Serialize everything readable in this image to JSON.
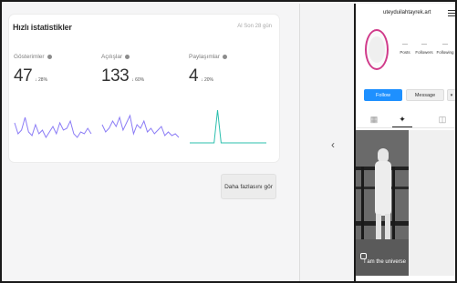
{
  "insights": {
    "title": "Hızlı istatistikler",
    "period": "Al Son 28 gün",
    "metrics": [
      {
        "label": "Gösterimler",
        "value": "47",
        "change": "↓ 28%",
        "color": "#8b7cf6",
        "spark": [
          18,
          30,
          26,
          12,
          28,
          32,
          20,
          30,
          26,
          34,
          28,
          22,
          30,
          18,
          26,
          24,
          16,
          30,
          34,
          28,
          30,
          24,
          30
        ]
      },
      {
        "label": "Açılışlar",
        "value": "133",
        "change": "↓ 60%",
        "color": "#8b7cf6",
        "spark": [
          20,
          28,
          24,
          16,
          22,
          12,
          26,
          18,
          10,
          30,
          20,
          24,
          16,
          28,
          24,
          30,
          26,
          22,
          32,
          28,
          32,
          30,
          34
        ]
      },
      {
        "label": "Paylaşımlar",
        "value": "4",
        "change": "↓ 20%",
        "color": "#2bbfae",
        "spark": [
          40,
          40,
          40,
          40,
          40,
          40,
          40,
          40,
          4,
          40,
          40,
          40,
          40,
          40,
          40,
          40,
          40,
          40,
          40,
          40,
          40,
          40,
          40
        ]
      }
    ],
    "more_label": "Daha fazlasını gör"
  },
  "nav": {
    "collapse_icon": "chevron-left-icon",
    "chevron_glyph": "‹"
  },
  "profile": {
    "username": "uteyduilahtayrek.art",
    "stats": [
      {
        "count": "—",
        "label": "Posts"
      },
      {
        "count": "—",
        "label": "Followers"
      },
      {
        "count": "—",
        "label": "Following"
      }
    ],
    "follow_label": "Follow",
    "message_label": "Message",
    "dropdown_glyph": "▾",
    "tabs": [
      {
        "name": "grid-icon",
        "glyph": "▦"
      },
      {
        "name": "reels-icon",
        "glyph": "✦"
      },
      {
        "name": "tagged-icon",
        "glyph": "◫"
      }
    ],
    "post_caption": "I am the universe"
  }
}
